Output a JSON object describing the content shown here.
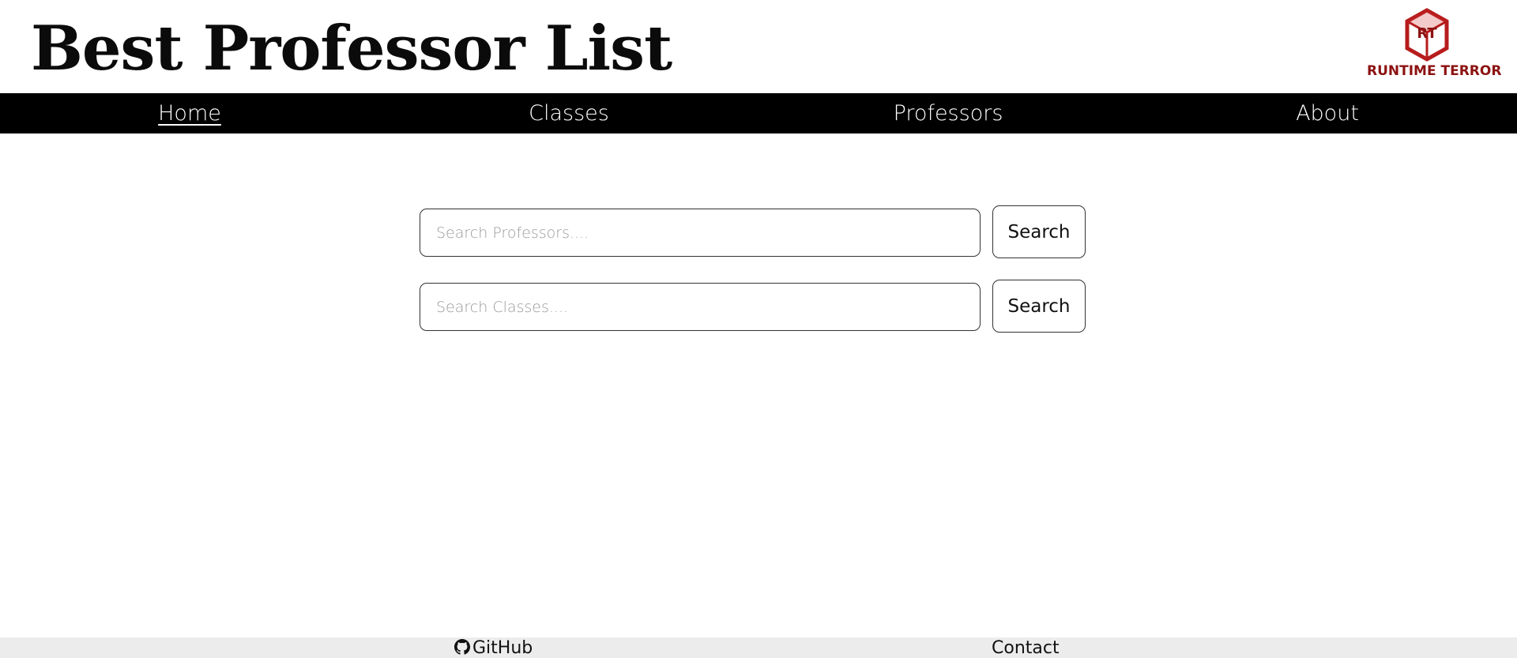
{
  "header": {
    "title": "Best Professor List",
    "logo": {
      "initials": "RT",
      "text": "RUNTIME TERROR",
      "color": "#8c1212",
      "icon": "cube-logo-icon"
    }
  },
  "nav": {
    "items": [
      {
        "label": "Home",
        "active": true
      },
      {
        "label": "Classes",
        "active": false
      },
      {
        "label": "Professors",
        "active": false
      },
      {
        "label": "About",
        "active": false
      }
    ]
  },
  "search": {
    "professors": {
      "placeholder": "Search Professors....",
      "value": "",
      "button_label": "Search"
    },
    "classes": {
      "placeholder": "Search Classes....",
      "value": "",
      "button_label": "Search"
    }
  },
  "footer": {
    "github_label": "GitHub",
    "github_icon": "github-icon",
    "contact_label": "Contact"
  },
  "colors": {
    "nav_background": "#000000",
    "nav_text": "#ffffff",
    "footer_background": "#ececec"
  }
}
